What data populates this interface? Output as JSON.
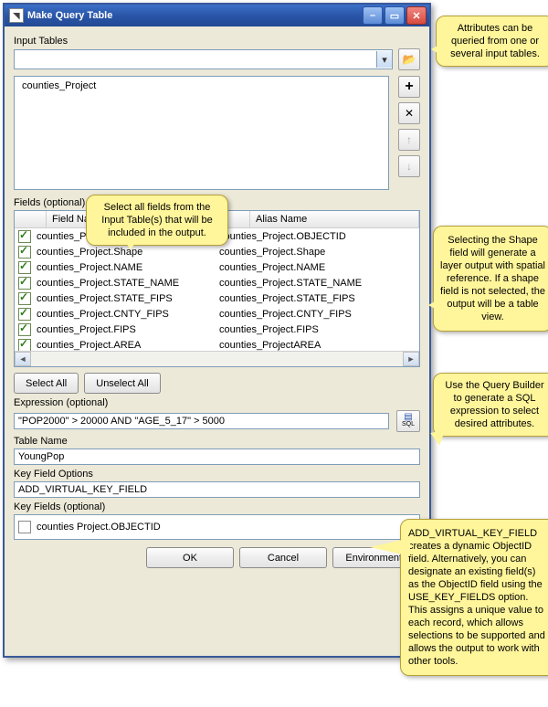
{
  "window": {
    "title": "Make Query Table"
  },
  "labels": {
    "input_tables": "Input Tables",
    "fields_optional": "Fields (optional)",
    "field_name_header": "Field Name",
    "alias_name_header": "Alias Name",
    "select_all": "Select All",
    "unselect_all": "Unselect All",
    "expression_optional": "Expression (optional)",
    "table_name": "Table Name",
    "key_field_options": "Key Field Options",
    "key_fields_optional": "Key Fields (optional)",
    "ok": "OK",
    "cancel": "Cancel",
    "environments": "Environments",
    "sql": "SQL"
  },
  "input_tables": {
    "items": [
      "counties_Project"
    ]
  },
  "fields": [
    {
      "checked": true,
      "field": "counties_Project.OBJECTID",
      "alias": "counties_Project.OBJECTID"
    },
    {
      "checked": true,
      "field": "counties_Project.Shape",
      "alias": "counties_Project.Shape"
    },
    {
      "checked": true,
      "field": "counties_Project.NAME",
      "alias": "counties_Project.NAME"
    },
    {
      "checked": true,
      "field": "counties_Project.STATE_NAME",
      "alias": "counties_Project.STATE_NAME"
    },
    {
      "checked": true,
      "field": "counties_Project.STATE_FIPS",
      "alias": "counties_Project.STATE_FIPS"
    },
    {
      "checked": true,
      "field": "counties_Project.CNTY_FIPS",
      "alias": "counties_Project.CNTY_FIPS"
    },
    {
      "checked": true,
      "field": "counties_Project.FIPS",
      "alias": "counties_Project.FIPS"
    },
    {
      "checked": true,
      "field": "counties_Project.AREA",
      "alias": "counties_ProjectAREA"
    }
  ],
  "values": {
    "expression": "\"POP2000\" > 20000 AND \"AGE_5_17\" > 5000",
    "table_name": "YoungPop",
    "key_field_option": "ADD_VIRTUAL_KEY_FIELD",
    "key_field_item": "counties Project.OBJECTID",
    "key_field_checked": false
  },
  "callouts": {
    "c1": "Attributes can be queried from one or several input tables.",
    "c2": "Select all fields from the Input Table(s) that will be included in the output.",
    "c3": "Selecting the Shape field will generate a layer output with spatial reference. If a shape field is not selected, the output will be a table view.",
    "c4": "Use the Query Builder to generate a SQL expression to select desired attributes.",
    "c5": "ADD_VIRTUAL_KEY_FIELD creates a dynamic ObjectID field.   Alternatively, you can designate an existing field(s) as the ObjectID field using the USE_KEY_FIELDS option.  This assigns a unique value to each record, which allows selections to be supported and allows the output to work with other tools."
  }
}
